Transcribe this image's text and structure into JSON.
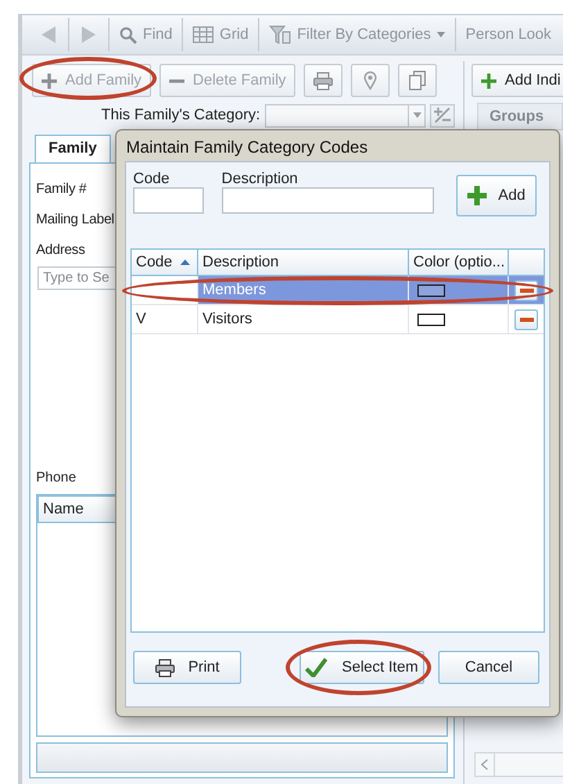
{
  "toolbar": [
    {
      "kind": "back"
    },
    {
      "kind": "forward"
    },
    {
      "kind": "find",
      "label": "Find"
    },
    {
      "kind": "grid",
      "label": "Grid"
    },
    {
      "kind": "filter",
      "label": "Filter By Categories",
      "dropdown": true
    },
    {
      "kind": "text",
      "label": "Person Look"
    }
  ],
  "family_actions": [
    {
      "kind": "add",
      "label": "Add Family",
      "disabled": true,
      "circled": true
    },
    {
      "kind": "delete",
      "label": "Delete Family",
      "disabled": true,
      "circled": false
    },
    {
      "kind": "print",
      "disabled": true,
      "circled": false
    },
    {
      "kind": "pin",
      "disabled": true,
      "circled": false
    },
    {
      "kind": "copy",
      "disabled": true,
      "circled": false
    }
  ],
  "individual_actions": [
    {
      "kind": "add",
      "label": "Add Indi",
      "disabled": false,
      "circled": false
    }
  ],
  "category": {
    "label": "This Family's Category:"
  },
  "groups_tab": {
    "label": "Groups"
  },
  "family_tab": {
    "label": "Family",
    "selected": true
  },
  "fields": [
    {
      "label": "Family #"
    },
    {
      "label": "Mailing Label"
    },
    {
      "label": "Address",
      "placeholder": "Type to Se"
    }
  ],
  "phone": {
    "label": "Phone",
    "columns": [
      "Name"
    ]
  },
  "dialog": {
    "title": "Maintain Family Category Codes",
    "code_label": "Code",
    "description_label": "Description",
    "add_button": "Add",
    "columns": [
      {
        "label": "Code",
        "sorted": true
      },
      {
        "label": "Description"
      },
      {
        "label": "Color (optio..."
      }
    ],
    "rows": [
      {
        "description": "Members",
        "color": "#8ea3dc",
        "selected": true,
        "circled": true
      },
      {
        "code": "V",
        "description": "Visitors",
        "color": "#ffffff",
        "selected": false,
        "circled": false
      }
    ],
    "buttons": [
      {
        "kind": "print",
        "label": "Print",
        "circled": false
      },
      {
        "kind": "select",
        "label": "Select Item",
        "circled": true
      },
      {
        "kind": "cancel",
        "label": "Cancel",
        "circled": false
      }
    ]
  }
}
